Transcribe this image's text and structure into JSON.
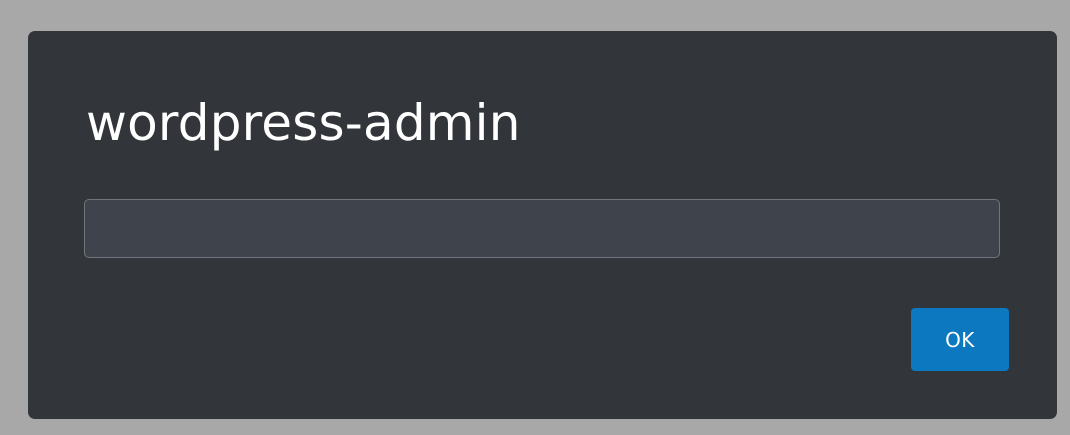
{
  "dialog": {
    "title": "wordpress-admin",
    "input": {
      "value": "",
      "placeholder": ""
    },
    "ok_label": "OK"
  },
  "colors": {
    "backdrop": "#a8a8a8",
    "dialog_background": "#32363b",
    "input_background": "#3e434c",
    "input_border": "#6f757d",
    "button_accent": "#0b78c0",
    "text": "#ffffff"
  }
}
